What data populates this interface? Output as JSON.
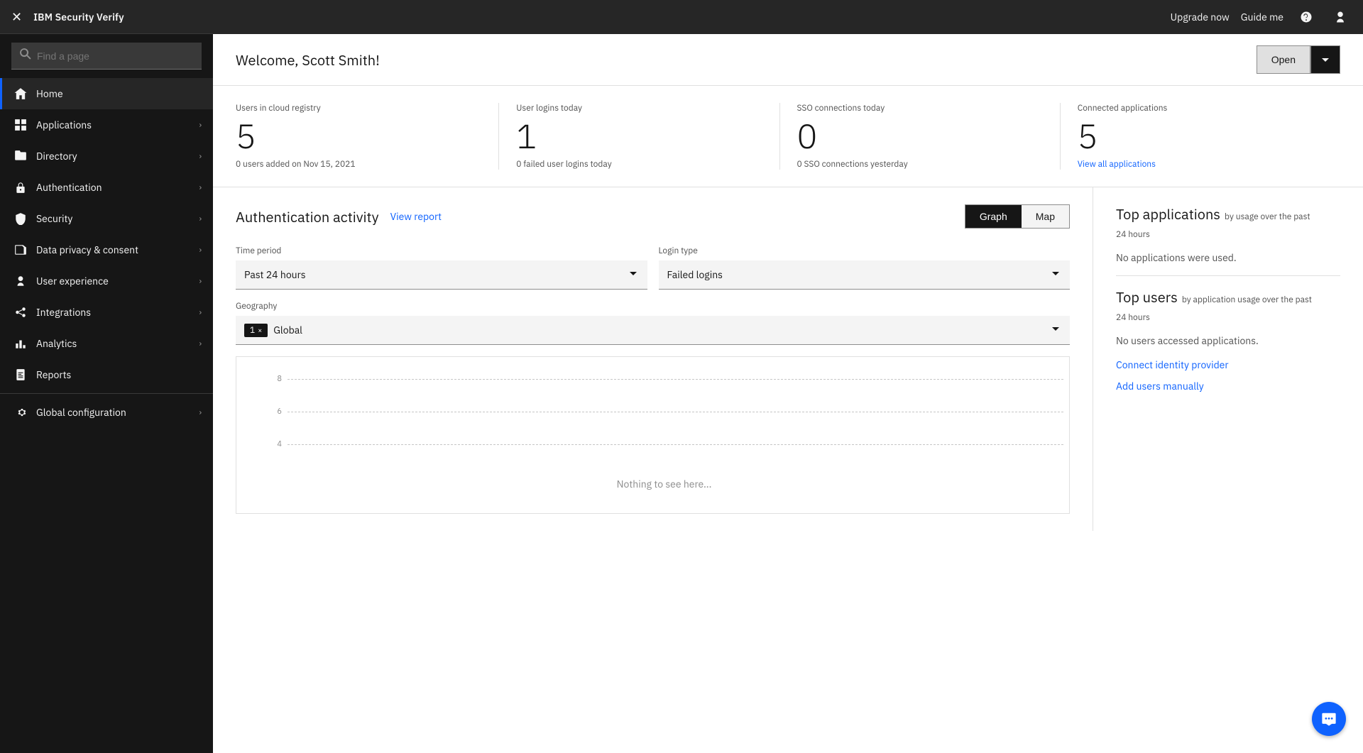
{
  "app": {
    "name": "IBM Security Verify",
    "close_icon": "✕"
  },
  "topbar": {
    "upgrade_label": "Upgrade now",
    "guide_label": "Guide me",
    "help_icon": "?",
    "user_icon": "👤"
  },
  "sidebar": {
    "search_placeholder": "Find a page",
    "items": [
      {
        "id": "home",
        "label": "Home",
        "icon": "🏠",
        "active": true,
        "expandable": false
      },
      {
        "id": "applications",
        "label": "Applications",
        "icon": "⊞",
        "active": false,
        "expandable": true
      },
      {
        "id": "directory",
        "label": "Directory",
        "icon": "📁",
        "active": false,
        "expandable": true
      },
      {
        "id": "authentication",
        "label": "Authentication",
        "icon": "🔒",
        "active": false,
        "expandable": true
      },
      {
        "id": "security",
        "label": "Security",
        "icon": "🛡",
        "active": false,
        "expandable": true
      },
      {
        "id": "data-privacy",
        "label": "Data privacy & consent",
        "icon": "📋",
        "active": false,
        "expandable": true
      },
      {
        "id": "user-experience",
        "label": "User experience",
        "icon": "👥",
        "active": false,
        "expandable": true
      },
      {
        "id": "integrations",
        "label": "Integrations",
        "icon": "🔗",
        "active": false,
        "expandable": true
      },
      {
        "id": "analytics",
        "label": "Analytics",
        "icon": "📊",
        "active": false,
        "expandable": true
      },
      {
        "id": "reports",
        "label": "Reports",
        "icon": "📄",
        "active": false,
        "expandable": false
      }
    ],
    "bottom_items": [
      {
        "id": "global-config",
        "label": "Global configuration",
        "icon": "⚙",
        "active": false,
        "expandable": true
      }
    ]
  },
  "welcome": {
    "title": "Welcome, Scott Smith!",
    "open_button": "Open",
    "chevron_icon": "⌄"
  },
  "stats": [
    {
      "id": "users-cloud",
      "label": "Users in cloud registry",
      "value": "5",
      "sub": "0 users added on Nov 15, 2021"
    },
    {
      "id": "user-logins",
      "label": "User logins today",
      "value": "1",
      "sub": "0 failed user logins today"
    },
    {
      "id": "sso-connections",
      "label": "SSO connections today",
      "value": "0",
      "sub": "0 SSO connections yesterday"
    },
    {
      "id": "connected-apps",
      "label": "Connected applications",
      "value": "5",
      "sub_link": "View all applications",
      "sub": ""
    }
  ],
  "auth_activity": {
    "title": "Authentication activity",
    "view_report": "View report",
    "graph_btn": "Graph",
    "map_btn": "Map",
    "time_period_label": "Time period",
    "time_period_value": "Past 24 hours",
    "login_type_label": "Login type",
    "login_type_value": "Failed logins",
    "geography_label": "Geography",
    "geography_tag": "1",
    "geography_tag_x": "×",
    "geography_value": "Global",
    "chart_nothing": "Nothing to see here...",
    "chart_y_labels": [
      "8",
      "6",
      "4"
    ]
  },
  "top_applications": {
    "title": "Top applications",
    "subtitle_prefix": "by usage over the past",
    "subtitle_time": "24 hours",
    "no_data": "No applications were used."
  },
  "top_users": {
    "title": "Top users",
    "subtitle_prefix": "by application usage over the past",
    "subtitle_time": "24 hours",
    "no_data": "No users accessed applications."
  },
  "action_links": [
    {
      "id": "connect-idp",
      "label": "Connect identity provider"
    },
    {
      "id": "add-users",
      "label": "Add users manually"
    }
  ],
  "fab": {
    "icon": "💬"
  }
}
